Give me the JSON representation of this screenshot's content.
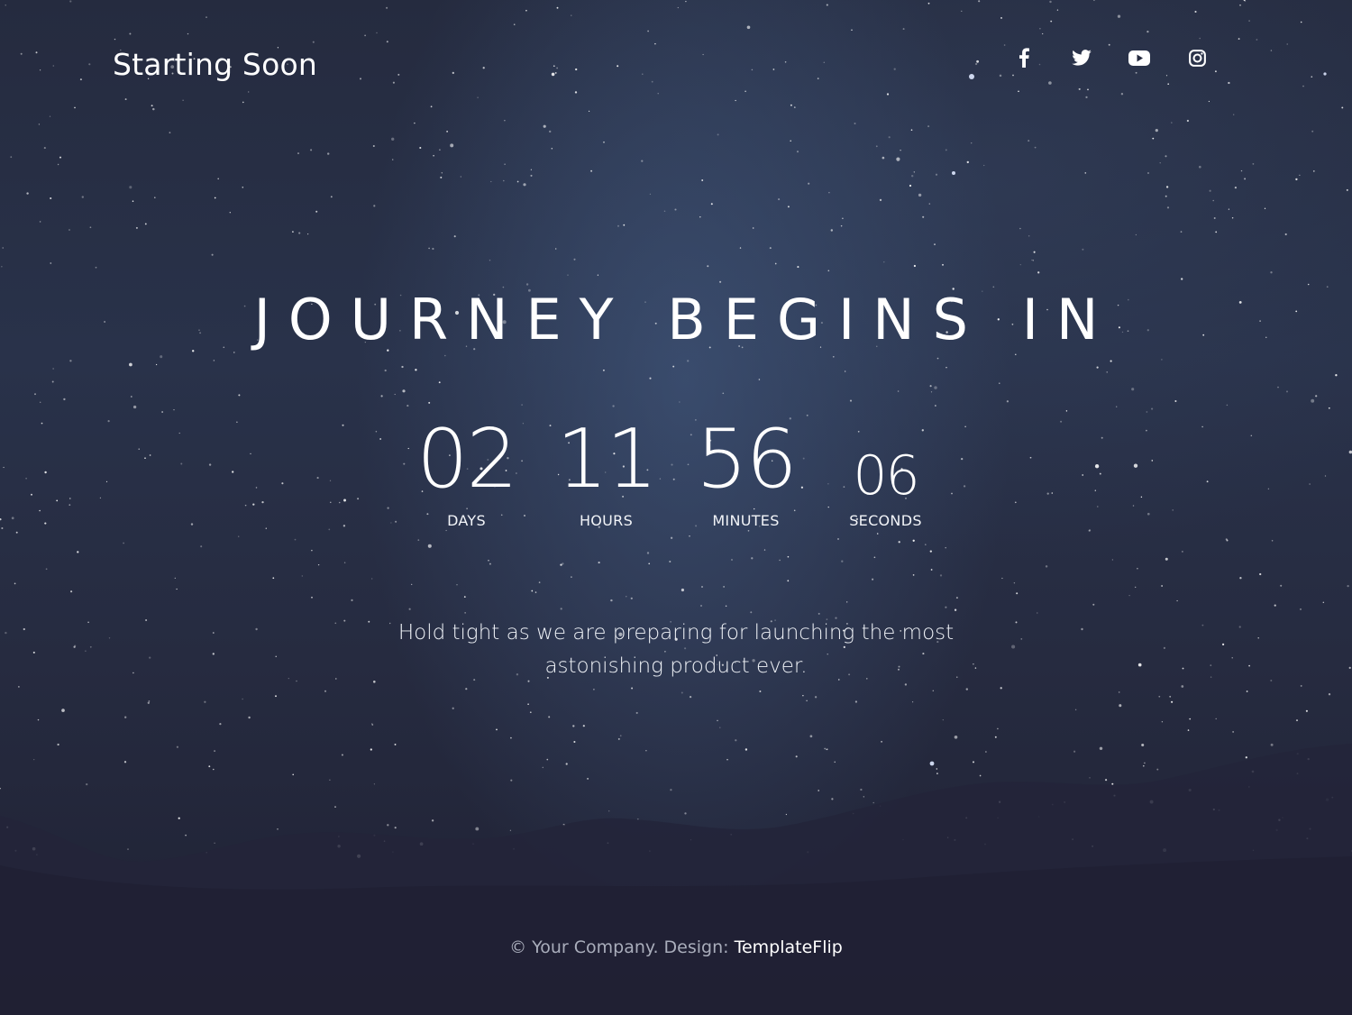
{
  "header": {
    "brand": "Starting Soon",
    "social": [
      {
        "name": "facebook-icon"
      },
      {
        "name": "twitter-icon"
      },
      {
        "name": "youtube-icon"
      },
      {
        "name": "instagram-icon"
      }
    ]
  },
  "hero": {
    "headline": "JOURNEY BEGINS IN",
    "countdown": {
      "days": {
        "value": "02",
        "label": "DAYS"
      },
      "hours": {
        "value": "11",
        "label": "HOURS"
      },
      "minutes": {
        "value": "56",
        "label": "MINUTES"
      },
      "seconds": {
        "value": "06",
        "label": "SECONDS"
      }
    },
    "tagline_line1": "Hold tight as we are preparing for launching the most",
    "tagline_line2": "astonishing product ever."
  },
  "footer": {
    "copyright": "© Your Company. Design: ",
    "credit_link": "TemplateFlip"
  },
  "colors": {
    "background": "#262b40",
    "text": "#ffffff",
    "footer_text": "#a9adbb"
  }
}
